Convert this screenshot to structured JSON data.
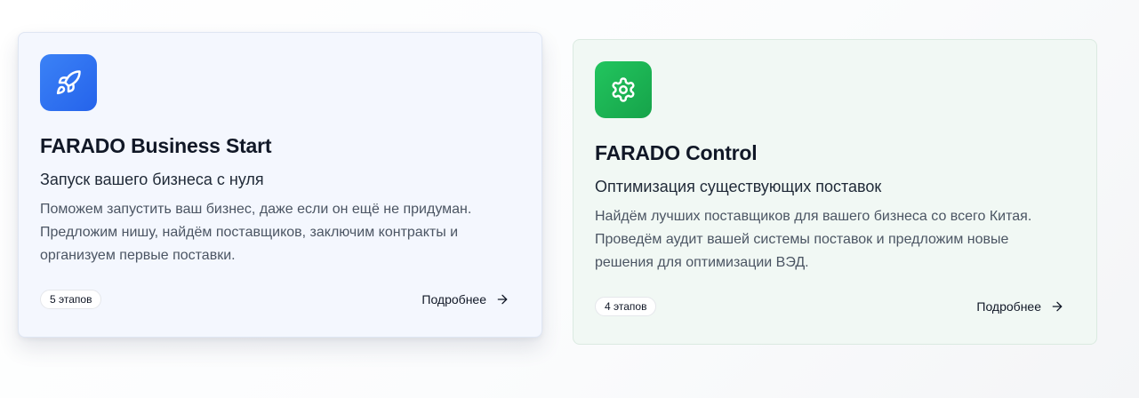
{
  "cards": [
    {
      "icon": "rocket-icon",
      "accent": "#2563eb",
      "title": "FARADO Business Start",
      "subtitle": "Запуск вашего бизнеса с нуля",
      "description": "Поможем запустить ваш бизнес, даже если он ещё не придуман. Предложим нишу, найдём поставщиков, заключим контракты и организуем первые поставки.",
      "badge": "5 этапов",
      "more_label": "Подробнее"
    },
    {
      "icon": "gear-icon",
      "accent": "#16a34a",
      "title": "FARADO Control",
      "subtitle": "Оптимизация существующих поставок",
      "description": "Найдём лучших поставщиков для вашего бизнеса со всего Китая. Проведём аудит вашей системы поставок и предложим новые решения для оптимизации ВЭД.",
      "badge": "4 этапов",
      "more_label": "Подробнее"
    }
  ]
}
